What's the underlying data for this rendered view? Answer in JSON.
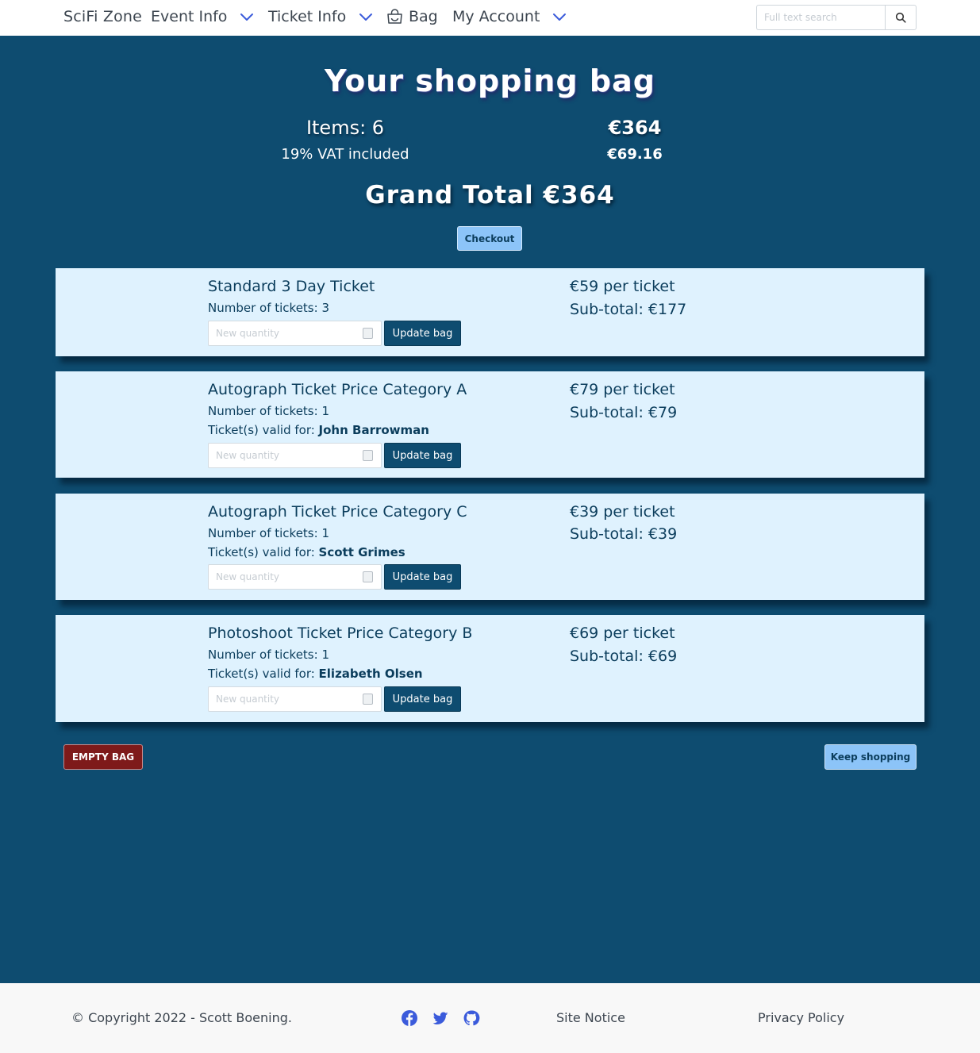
{
  "nav": {
    "brand": "SciFi Zone",
    "event_info": "Event Info",
    "ticket_info": "Ticket Info",
    "bag": "Bag",
    "my_account": "My Account",
    "search_placeholder": "Full text search"
  },
  "summary": {
    "title": "Your shopping bag",
    "items_label": "Items: 6",
    "items_total": "€364",
    "vat_label": "19% VAT included",
    "vat_total": "€69.16",
    "grand_total": "Grand Total €364",
    "checkout_label": "Checkout"
  },
  "items": [
    {
      "name": "Standard 3 Day Ticket",
      "count": "Number of tickets: 3",
      "valid_prefix": "",
      "valid_for": "",
      "qty_placeholder": "New quantity",
      "update_label": "Update bag",
      "unit_price": "€59 per ticket",
      "subtotal": "Sub-total: €177"
    },
    {
      "name": "Autograph Ticket Price Category A",
      "count": "Number of tickets: 1",
      "valid_prefix": "Ticket(s) valid for: ",
      "valid_for": "John Barrowman",
      "qty_placeholder": "New quantity",
      "update_label": "Update bag",
      "unit_price": "€79 per ticket",
      "subtotal": "Sub-total: €79"
    },
    {
      "name": "Autograph Ticket Price Category C",
      "count": "Number of tickets: 1",
      "valid_prefix": "Ticket(s) valid for: ",
      "valid_for": "Scott Grimes",
      "qty_placeholder": "New quantity",
      "update_label": "Update bag",
      "unit_price": "€39 per ticket",
      "subtotal": "Sub-total: €39"
    },
    {
      "name": "Photoshoot Ticket Price Category B",
      "count": "Number of tickets: 1",
      "valid_prefix": "Ticket(s) valid for: ",
      "valid_for": "Elizabeth Olsen",
      "qty_placeholder": "New quantity",
      "update_label": "Update bag",
      "unit_price": "€69 per ticket",
      "subtotal": "Sub-total: €69"
    }
  ],
  "actions": {
    "empty_bag": "EMPTY BAG",
    "keep_shopping": "Keep shopping"
  },
  "footer": {
    "copyright": "© Copyright 2022 - Scott Boening.",
    "social_icons": [
      "facebook-icon",
      "twitter-icon",
      "github-icon"
    ],
    "site_notice": "Site Notice",
    "privacy_policy": "Privacy Policy"
  },
  "colors": {
    "background": "#0e4c70",
    "card": "#dff2fe",
    "accent_button": "#8cc4f8",
    "danger_button": "#7e1a1a",
    "icon_blue": "#3b5bdb"
  }
}
